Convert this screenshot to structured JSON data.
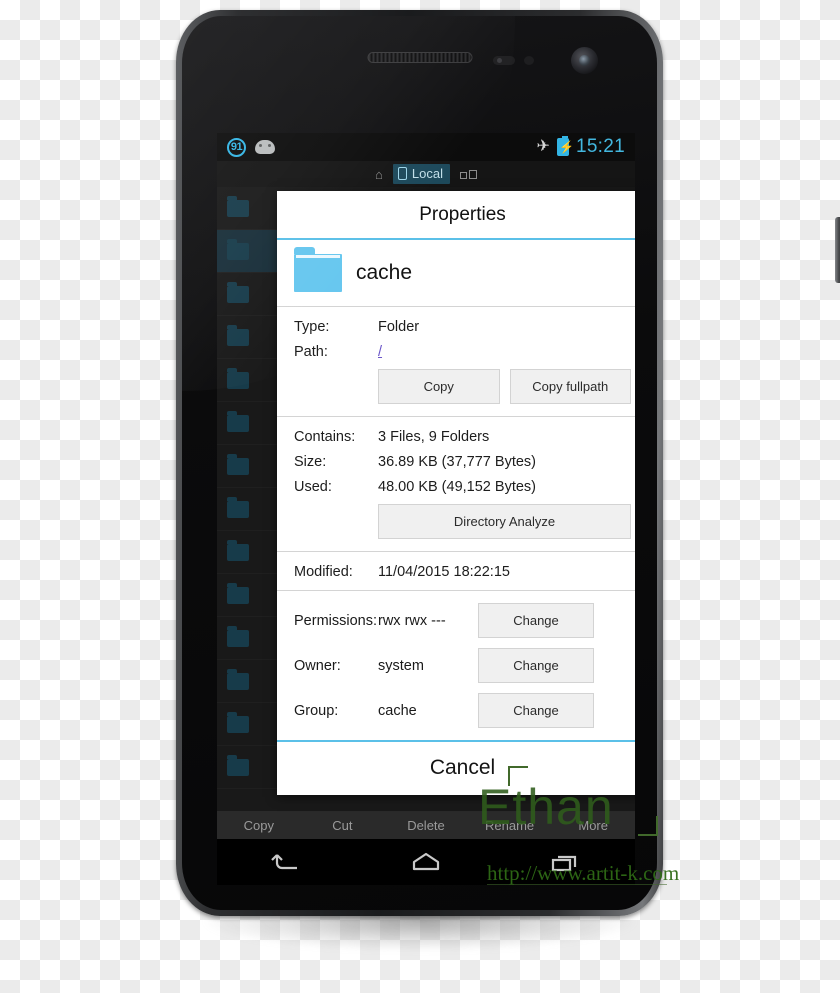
{
  "status_bar": {
    "notification_badge": "91",
    "android_icon": "android-face-icon",
    "airplane_icon": "airplane-mode-icon",
    "battery_icon": "battery-charging-icon",
    "battery_glyph": "⚡",
    "clock": "15:21"
  },
  "app_tabbar": {
    "home_icon": "home-icon",
    "home_glyph": "⌂",
    "local_tab_label": "Local",
    "remote_icon": "network-share-icon"
  },
  "file_list": {
    "rows": [
      {
        "name": "",
        "selected": false
      },
      {
        "name": "",
        "selected": true
      },
      {
        "name": "",
        "selected": false
      },
      {
        "name": "",
        "selected": false
      },
      {
        "name": "",
        "selected": false
      },
      {
        "name": "",
        "selected": false
      },
      {
        "name": "",
        "selected": false
      },
      {
        "name": "",
        "selected": false
      },
      {
        "name": "",
        "selected": false
      },
      {
        "name": "",
        "selected": false
      },
      {
        "name": "",
        "selected": false
      },
      {
        "name": "",
        "selected": false
      },
      {
        "name": "",
        "selected": false
      },
      {
        "name": "",
        "selected": false
      }
    ]
  },
  "action_bar": {
    "items": [
      "Copy",
      "Cut",
      "Delete",
      "Rename",
      "More"
    ]
  },
  "nav_bar": {
    "back_icon": "back-arrow-icon",
    "home_icon": "home-nav-icon",
    "recents_icon": "recent-apps-icon"
  },
  "dialog": {
    "title": "Properties",
    "file_name": "cache",
    "folder_icon": "folder-icon",
    "type_label": "Type:",
    "type_value": "Folder",
    "path_label": "Path:",
    "path_value": "/",
    "copy_button": "Copy",
    "copy_fullpath_button": "Copy fullpath",
    "contains_label": "Contains:",
    "contains_value": "3 Files, 9 Folders",
    "size_label": "Size:",
    "size_value": "36.89 KB (37,777 Bytes)",
    "used_label": "Used:",
    "used_value": "48.00 KB (49,152 Bytes)",
    "directory_analyze_button": "Directory Analyze",
    "modified_label": "Modified:",
    "modified_value": "11/04/2015 18:22:15",
    "permissions_label": "Permissions:",
    "permissions_value": "rwx rwx ---",
    "permissions_change_button": "Change",
    "owner_label": "Owner:",
    "owner_value": "system",
    "owner_change_button": "Change",
    "group_label": "Group:",
    "group_value": "cache",
    "group_change_button": "Change",
    "cancel_button": "Cancel"
  },
  "watermark": {
    "brand": "Ethan",
    "url": "http://www.artit-k.com"
  },
  "colors": {
    "accent_blue": "#5bc0e8",
    "status_blue": "#33b5e5",
    "folder_blue": "#67c7ef",
    "link_purple": "#6a55c8",
    "button_gray": "#f0f0f0",
    "watermark_green": "#2f6b16"
  }
}
